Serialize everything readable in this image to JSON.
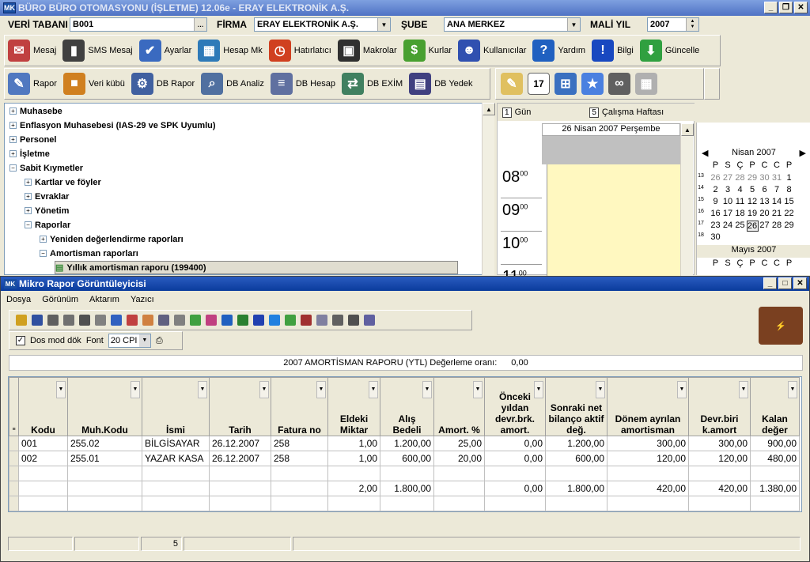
{
  "app": {
    "title": "BÜRO BÜRO OTOMASYONU (İŞLETME) 12.06e - ERAY ELEKTRONİK A.Ş.",
    "logo": "MK"
  },
  "topbar": {
    "veritabani_label": "VERİ TABANI",
    "veritabani": "B001",
    "firma_label": "FİRMA",
    "firma": "ERAY ELEKTRONİK A.Ş.",
    "sube_label": "ŞUBE",
    "sube": "ANA MERKEZ",
    "mali_yil_label": "MALİ YIL",
    "mali_yil": "2007"
  },
  "toolbar1": [
    {
      "label": "Mesaj",
      "icon": "mailbox-icon",
      "color": "#c04040",
      "glyph": "✉"
    },
    {
      "label": "SMS Mesaj",
      "icon": "mobile-phone-icon",
      "color": "#404040",
      "glyph": "▮"
    },
    {
      "label": "Ayarlar",
      "icon": "checklist-icon",
      "color": "#3a6ac0",
      "glyph": "✔"
    },
    {
      "label": "Hesap Mk",
      "icon": "calculator-icon",
      "color": "#2e7ab8",
      "glyph": "▦"
    },
    {
      "label": "Hatırlatıcı",
      "icon": "alarm-clock-icon",
      "color": "#d04020",
      "glyph": "◷"
    },
    {
      "label": "Makrolar",
      "icon": "tape-recorder-icon",
      "color": "#303030",
      "glyph": "▣"
    },
    {
      "label": "Kurlar",
      "icon": "money-icon",
      "color": "#48a030",
      "glyph": "$"
    },
    {
      "label": "Kullanıcılar",
      "icon": "users-icon",
      "color": "#3050b0",
      "glyph": "☻"
    },
    {
      "label": "Yardım",
      "icon": "help-icon",
      "color": "#2060c0",
      "glyph": "?"
    },
    {
      "label": "Bilgi",
      "icon": "info-icon",
      "color": "#1848c0",
      "glyph": "!"
    },
    {
      "label": "Güncelle",
      "icon": "update-globe-icon",
      "color": "#30a040",
      "glyph": "⬇"
    }
  ],
  "toolbar2": [
    {
      "label": "Rapor",
      "icon": "report-icon",
      "color": "#5078c0",
      "glyph": "✎"
    },
    {
      "label": "Veri kübü",
      "icon": "data-cube-icon",
      "color": "#d08020",
      "glyph": "■"
    },
    {
      "label": "DB Rapor",
      "icon": "db-report-icon",
      "color": "#4060a0",
      "glyph": "⚙"
    },
    {
      "label": "DB Analiz",
      "icon": "db-analyze-icon",
      "color": "#5070a0",
      "glyph": "⌕"
    },
    {
      "label": "DB Hesap",
      "icon": "db-calc-icon",
      "color": "#6070a0",
      "glyph": "≡"
    },
    {
      "label": "DB EXİM",
      "icon": "db-exim-icon",
      "color": "#408060",
      "glyph": "⇄"
    },
    {
      "label": "DB Yedek",
      "icon": "db-backup-icon",
      "color": "#404080",
      "glyph": "▤"
    }
  ],
  "tree": [
    {
      "label": "Muhasebe",
      "sign": "+",
      "level": 0
    },
    {
      "label": "Enflasyon Muhasebesi (IAS-29 ve SPK Uyumlu)",
      "sign": "+",
      "level": 0
    },
    {
      "label": "Personel",
      "sign": "+",
      "level": 0
    },
    {
      "label": "İşletme",
      "sign": "+",
      "level": 0
    },
    {
      "label": "Sabit Kıymetler",
      "sign": "−",
      "level": 0
    },
    {
      "label": "Kartlar ve föyler",
      "sign": "+",
      "level": 1
    },
    {
      "label": "Evraklar",
      "sign": "+",
      "level": 1
    },
    {
      "label": "Yönetim",
      "sign": "+",
      "level": 1
    },
    {
      "label": "Raporlar",
      "sign": "−",
      "level": 1
    },
    {
      "label": "Yeniden değerlendirme raporları",
      "sign": "+",
      "level": 2
    },
    {
      "label": "Amortisman raporları",
      "sign": "−",
      "level": 2
    },
    {
      "label": "Yıllık amortisman raporu (199400)",
      "sign": "",
      "level": 3
    }
  ],
  "schedule": {
    "gun": "Gün",
    "calisma_haftasi": "Çalışma Haftası",
    "gun_num": "1",
    "hafta_num": "5",
    "date_header": "26 Nisan 2007 Perşembe",
    "hours": [
      "08",
      "09",
      "10",
      "11"
    ],
    "minutes": "00"
  },
  "calendar": {
    "month1": "Nisan 2007",
    "month2": "Mayıs 2007",
    "days": [
      "P",
      "S",
      "Ç",
      "P",
      "C",
      "C",
      "P"
    ],
    "weeks": [
      {
        "wk": "13",
        "d": [
          "26",
          "27",
          "28",
          "29",
          "30",
          "31",
          "1"
        ]
      },
      {
        "wk": "14",
        "d": [
          "2",
          "3",
          "4",
          "5",
          "6",
          "7",
          "8"
        ]
      },
      {
        "wk": "15",
        "d": [
          "9",
          "10",
          "11",
          "12",
          "13",
          "14",
          "15"
        ]
      },
      {
        "wk": "16",
        "d": [
          "16",
          "17",
          "18",
          "19",
          "20",
          "21",
          "22"
        ]
      },
      {
        "wk": "17",
        "d": [
          "23",
          "24",
          "25",
          "26",
          "27",
          "28",
          "29"
        ]
      },
      {
        "wk": "18",
        "d": [
          "30",
          "",
          "",
          "",
          "",
          "",
          ""
        ]
      }
    ],
    "today": "26"
  },
  "viewer": {
    "title": "Mikro Rapor Görüntüleyicisi",
    "menu": [
      "Dosya",
      "Görünüm",
      "Aktarım",
      "Yazıcı"
    ],
    "dos_mod": "Dos mod dök",
    "font_label": "Font",
    "font_value": "20 CPI",
    "report_title": "2007 AMORTİSMAN RAPORU (YTL)  Değerleme oranı:",
    "report_rate": "0,00",
    "columns": [
      "Kodu",
      "Muh.Kodu",
      "İsmi",
      "Tarih",
      "Fatura no",
      "Eldeki Miktar",
      "Alış Bedeli",
      "Amort. %",
      "Önceki yıldan devr.brk. amort.",
      "Sonraki net bilanço aktif değ.",
      "Dönem ayrılan amortisman",
      "Devr.biri k.amort",
      "Kalan değer"
    ],
    "rows": [
      [
        "001",
        "255.02",
        "BİLGİSAYAR",
        "26.12.2007",
        "258",
        "1,00",
        "1.200,00",
        "25,00",
        "0,00",
        "1.200,00",
        "300,00",
        "300,00",
        "900,00"
      ],
      [
        "002",
        "255.01",
        "YAZAR KASA",
        "26.12.2007",
        "258",
        "1,00",
        "600,00",
        "20,00",
        "0,00",
        "600,00",
        "120,00",
        "120,00",
        "480,00"
      ],
      [
        "",
        "",
        "",
        "",
        "",
        "",
        "",
        "",
        "",
        "",
        "",
        "",
        ""
      ],
      [
        "",
        "",
        "",
        "",
        "",
        "2,00",
        "1.800,00",
        "",
        "0,00",
        "1.800,00",
        "420,00",
        "420,00",
        "1.380,00"
      ],
      [
        "",
        "",
        "",
        "",
        "",
        "",
        "",
        "",
        "",
        "",
        "",
        "",
        ""
      ]
    ],
    "status_count": "5"
  }
}
